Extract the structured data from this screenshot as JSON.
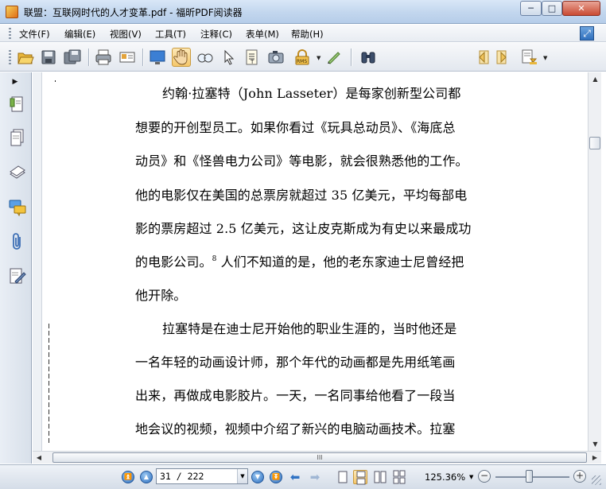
{
  "window": {
    "title": "联盟：互联网时代的人才变革.pdf - 福昕PDF阅读器",
    "controls": {
      "minimize": "─",
      "maximize": "□",
      "close": "✕"
    }
  },
  "menu": [
    {
      "label": "文件(F)"
    },
    {
      "label": "编辑(E)"
    },
    {
      "label": "视图(V)"
    },
    {
      "label": "工具(T)"
    },
    {
      "label": "注释(C)"
    },
    {
      "label": "表单(M)"
    },
    {
      "label": "帮助(H)"
    }
  ],
  "toolbar": {
    "search": {
      "value": "",
      "placeholder": ""
    },
    "icons": [
      "open-folder-icon",
      "save-icon",
      "save-as-icon",
      "print-icon",
      "email-icon",
      "fullscreen-icon",
      "hand-tool-icon",
      "zoom-tool-icon",
      "select-arrow-icon",
      "text-select-icon",
      "snapshot-icon",
      "rms-icon",
      "typewriter-icon",
      "binoculars-icon",
      "prev-result-icon",
      "next-result-icon",
      "highlight-options-icon"
    ]
  },
  "sidebar": {
    "icons": [
      "bookmarks-icon",
      "pages-icon",
      "layers-icon",
      "comments-icon",
      "attachments-icon",
      "signatures-icon"
    ]
  },
  "document": {
    "paragraphs": [
      {
        "lines": [
          "约翰·拉塞特（John Lasseter）是每家创新型公司都",
          "想要的开创型员工。如果你看过《玩具总动员》、《海底总",
          "动员》和《怪兽电力公司》等电影，就会很熟悉他的工作。",
          "他的电影仅在美国的总票房就超过 35 亿美元，平均每部电",
          "影的票房超过 2.5 亿美元，这让皮克斯成为有史以来最成功",
          "的电影公司。",
          "他开除。"
        ],
        "footnote_ref": "8",
        "line6_tail": " 人们不知道的是，他的老东家迪士尼曾经把"
      },
      {
        "lines": [
          "拉塞特是在迪士尼开始他的职业生涯的，当时他还是",
          "一名年轻的动画设计师，那个年代的动画都是先用纸笔画",
          "出来，再做成电影胶片。一天，一名同事给他看了一段当",
          "地会议的视频，视频中介绍了新兴的电脑动画技术。拉塞"
        ]
      }
    ]
  },
  "statusbar": {
    "page_field": "31 / 222",
    "current_page": 31,
    "total_pages": 222,
    "zoom": "125.36%",
    "zoom_fraction": 0.46,
    "hscroll_grip": "III"
  },
  "colors": {
    "titlebar": "#c2d6ee",
    "hand_tool_active": "#f5c76a",
    "nav_blue": "#2d6fbf"
  }
}
